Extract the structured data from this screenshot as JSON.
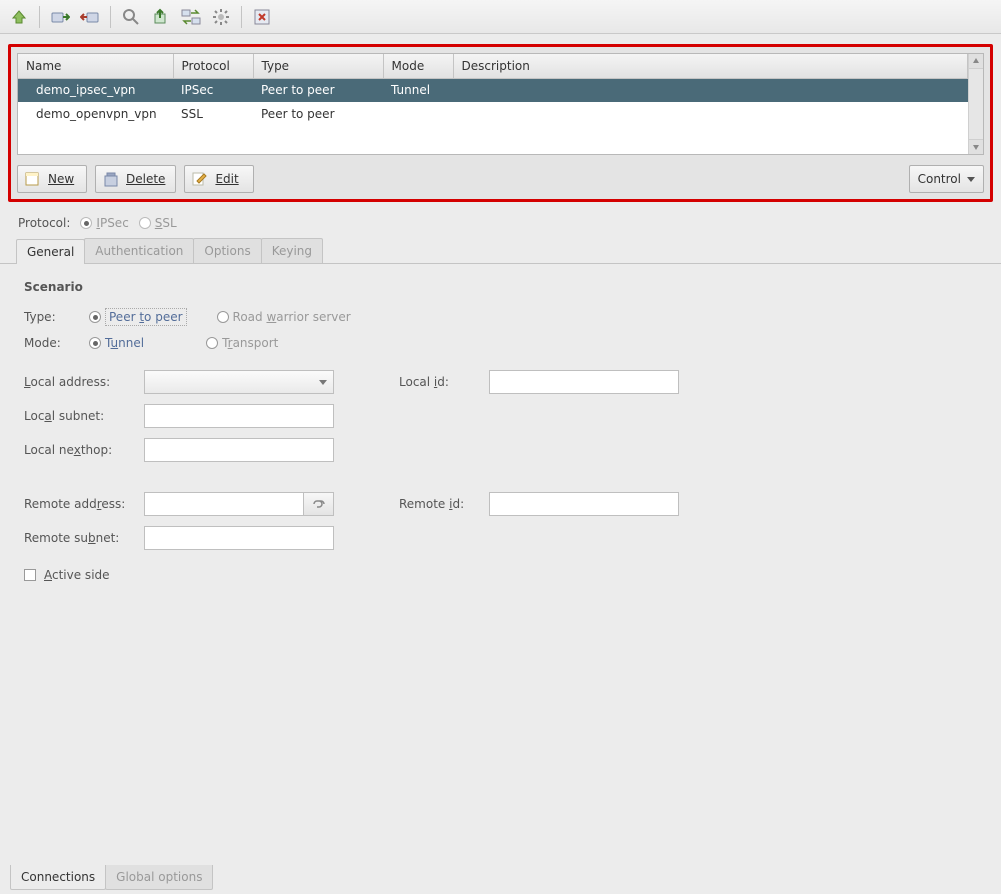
{
  "toolbar_icons": [
    "home-up-icon",
    "sep",
    "server-in-icon",
    "server-out-icon",
    "sep",
    "search-icon",
    "export-icon",
    "exchange-icon",
    "gear-icon",
    "sep",
    "window-close-icon"
  ],
  "columns": [
    "Name",
    "Protocol",
    "Type",
    "Mode",
    "Description"
  ],
  "rows": [
    {
      "name": "demo_ipsec_vpn",
      "protocol": "IPSec",
      "type": "Peer to peer",
      "mode": "Tunnel",
      "description": "",
      "selected": true
    },
    {
      "name": "demo_openvpn_vpn",
      "protocol": "SSL",
      "type": "Peer to peer",
      "mode": "",
      "description": "",
      "selected": false
    }
  ],
  "buttons": {
    "new": "New",
    "delete": "Delete",
    "edit": "Edit",
    "control": "Control"
  },
  "protocol": {
    "label": "Protocol:",
    "ipsec": "IPSec",
    "ssl": "SSL",
    "selected": "ipsec"
  },
  "tabs": [
    "General",
    "Authentication",
    "Options",
    "Keying"
  ],
  "active_tab": "General",
  "scenario": {
    "title": "Scenario",
    "type_label": "Type:",
    "type_peer": "Peer to peer",
    "type_rw": "Road warrior server",
    "mode_label": "Mode:",
    "mode_tunnel": "Tunnel",
    "mode_transport": "Transport"
  },
  "fields": {
    "local_address": "Local address:",
    "local_id": "Local id:",
    "local_subnet": "Local subnet:",
    "local_nexthop": "Local nexthop:",
    "remote_address": "Remote address:",
    "remote_id": "Remote id:",
    "remote_subnet": "Remote subnet:",
    "active_side": "Active side"
  },
  "bottom_tabs": [
    "Connections",
    "Global options"
  ],
  "active_bottom_tab": "Connections"
}
